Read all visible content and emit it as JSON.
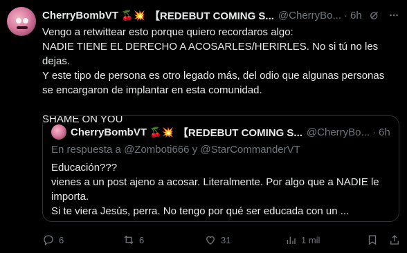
{
  "tweet": {
    "author_name": "CherryBombVT",
    "author_emoji": "🍒💥",
    "author_suffix": "【REDEBUT COMING S...",
    "handle": "@CherryBo...",
    "time": "6h",
    "text": "Vengo a retwittear esto porque quiero recordaros algo:\nNADIE TIENE EL DERECHO A ACOSARLES/HERIRLES. No si tú no les dejas.\nY este tipo de persona es otro legado más, del odio que algunas personas\nse encargaron de implantar en esta comunidad.\n\nSHAME ON YOU"
  },
  "quote": {
    "author_name": "CherryBombVT",
    "author_emoji": "🍒💥",
    "author_suffix": "【REDEBUT COMING S...",
    "handle": "@CherryBo...",
    "time": "6h",
    "reply_prefix": "En respuesta a",
    "reply_user1": "@Zomboti666",
    "reply_and": "y",
    "reply_user2": "@StarCommanderVT",
    "text": "Educación???\nvienes a un post ajeno a acosar. Literalmente. Por algo que a NADIE le\nimporta.\nSi te viera Jesús, perra. No tengo por qué ser educada con un ..."
  },
  "actions": {
    "replies": "6",
    "retweets": "6",
    "likes": "31",
    "views": "1 mil"
  },
  "colors": {
    "background": "#000000",
    "text": "#e7e9ea",
    "muted": "#71767b",
    "border": "#2f3336"
  },
  "icons": {
    "header": [
      "grok-icon",
      "more-icon"
    ],
    "actions": [
      "reply-icon",
      "retweet-icon",
      "like-icon",
      "views-icon",
      "bookmark-icon",
      "share-icon"
    ]
  }
}
